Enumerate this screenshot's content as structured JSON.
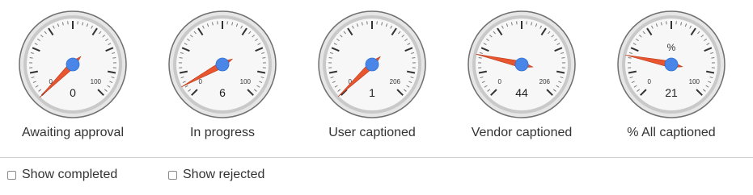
{
  "gauges": [
    {
      "label": "Awaiting approval",
      "value": "0",
      "min_label": "0",
      "max_label": "100",
      "needle_level": 0.0
    },
    {
      "label": "In progress",
      "value": "6",
      "min_label": "0",
      "max_label": "100",
      "needle_level": 0.06
    },
    {
      "label": "User captioned",
      "value": "1",
      "min_label": "0",
      "max_label": "206",
      "needle_level": 0.005
    },
    {
      "label": "Vendor captioned",
      "value": "44",
      "min_label": "0",
      "max_label": "206",
      "needle_level": 0.214
    },
    {
      "label": "% All captioned",
      "value": "21",
      "min_label": "0",
      "max_label": "100",
      "unit": "%",
      "needle_level": 0.21
    }
  ],
  "options": [
    {
      "label": "Show completed",
      "checked": false
    },
    {
      "label": "Show rejected",
      "checked": false
    }
  ],
  "colors": {
    "needle": "#e8552f",
    "hub": "#4a86e8",
    "dial_face": "#f7f7f7",
    "bezel": "#cfcfcf",
    "text": "#333333"
  }
}
